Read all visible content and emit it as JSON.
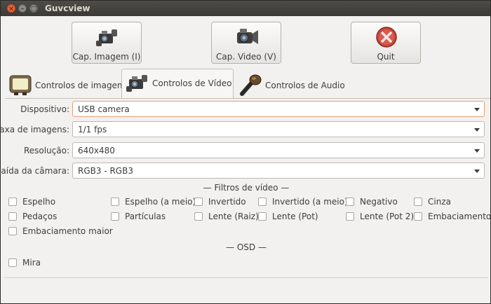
{
  "window": {
    "title": "Guvcview"
  },
  "buttons": {
    "capture_image": "Cap. Imagem (I)",
    "capture_video": "Cap. Video (V)",
    "quit": "Quit"
  },
  "tabs": [
    {
      "label": "Controlos de imagem",
      "icon": "tv-icon"
    },
    {
      "label": "Controlos de Vídeo",
      "icon": "camera-icon",
      "active": true
    },
    {
      "label": "Controlos de Audio",
      "icon": "microphone-icon"
    }
  ],
  "form": {
    "device": {
      "label": "Dispositivo:",
      "value": "USB camera"
    },
    "frame_rate": {
      "label": "Taxa de imagens:",
      "value": "1/1 fps"
    },
    "resolution": {
      "label": "Resolução:",
      "value": "640x480"
    },
    "camera_output": {
      "label": "Saída da câmara:",
      "value": "RGB3 - RGB3"
    }
  },
  "filters": {
    "heading": "— Filtros de vídeo —",
    "items": [
      "Espelho",
      "Espelho (a meio)",
      "Invertido",
      "Invertido (a meio)",
      "Negativo",
      "Cinza",
      "Pedaços",
      "Partículas",
      "Lente (Raiz)",
      "Lente (Pot)",
      "Lente (Pot 2)",
      "Embaciamento",
      "Embaciamento maior"
    ]
  },
  "osd": {
    "heading": "— OSD —",
    "items": [
      "Mira"
    ]
  }
}
